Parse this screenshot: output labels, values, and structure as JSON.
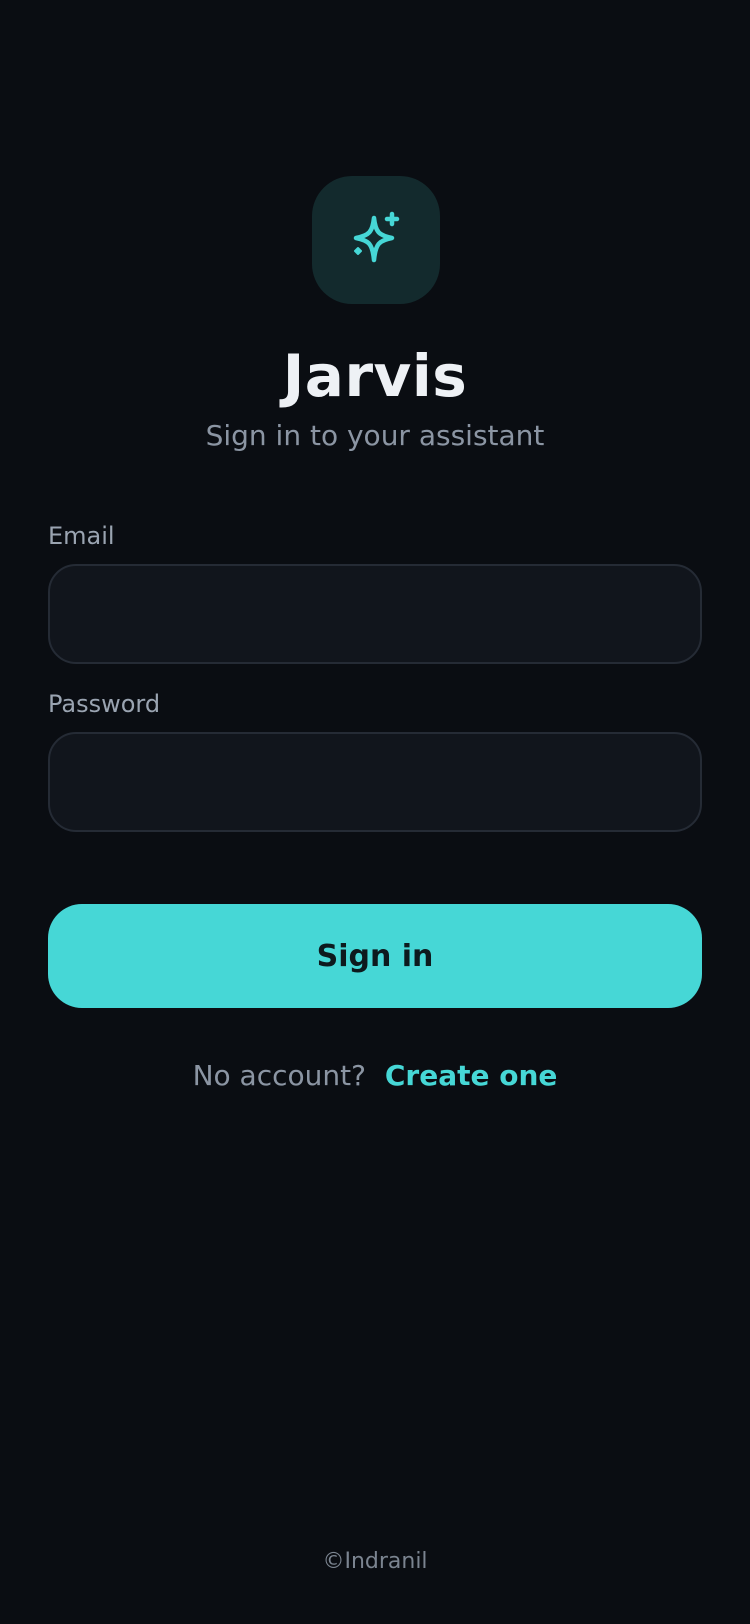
{
  "app": {
    "title": "Jarvis",
    "subtitle": "Sign in to your assistant",
    "logo_icon": "sparkles-icon",
    "accent_color": "#46d7d6",
    "background_color": "#0a0d12"
  },
  "form": {
    "email_label": "Email",
    "email_value": "",
    "email_placeholder": "",
    "password_label": "Password",
    "password_value": "",
    "password_placeholder": "",
    "submit_label": "Sign in"
  },
  "signup": {
    "prompt": "No account?",
    "link_label": "Create one"
  },
  "footer": {
    "copyright": "©Indranil"
  }
}
